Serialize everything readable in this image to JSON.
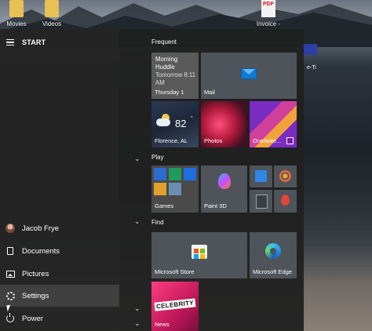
{
  "desktop": {
    "icons": [
      {
        "label": "Movies",
        "icon": "folder-icon"
      },
      {
        "label": "Videos",
        "icon": "folder-icon"
      },
      {
        "label": "Invoice -",
        "icon": "pdf-icon",
        "badge": "PDF"
      }
    ],
    "partial_right_label": "e-Ti"
  },
  "start": {
    "title": "START",
    "nav": [
      {
        "id": "user",
        "label": "Jacob Frye",
        "icon": "avatar"
      },
      {
        "id": "documents",
        "label": "Documents",
        "icon": "document-icon"
      },
      {
        "id": "pictures",
        "label": "Pictures",
        "icon": "pictures-icon"
      },
      {
        "id": "settings",
        "label": "Settings",
        "icon": "gear-icon",
        "selected": true
      },
      {
        "id": "power",
        "label": "Power",
        "icon": "power-icon"
      }
    ],
    "groups": {
      "frequent": "Frequent",
      "play": "Play",
      "find": "Find"
    },
    "tiles": {
      "calendar": {
        "event_title": "Morning Huddle",
        "event_time": "Tomorrow 8:11 AM",
        "label": "Thursday 1"
      },
      "mail": {
        "label": "Mail"
      },
      "weather": {
        "temp": "82",
        "unit": "°",
        "label": "Florence, AL"
      },
      "photos": {
        "label": "Photos"
      },
      "onenote": {
        "label": "OneNote..."
      },
      "games": {
        "label": "Games"
      },
      "paint3d": {
        "label": "Paint 3D"
      },
      "store": {
        "label": "Microsoft Store"
      },
      "edge": {
        "label": "Microsoft Edge"
      },
      "news": {
        "label": "News",
        "banner": "CELEBRITY"
      }
    }
  },
  "colors": {
    "accent": "#0f79d4",
    "tile_bg": "#4e5459",
    "menu_bg": "#202020"
  }
}
